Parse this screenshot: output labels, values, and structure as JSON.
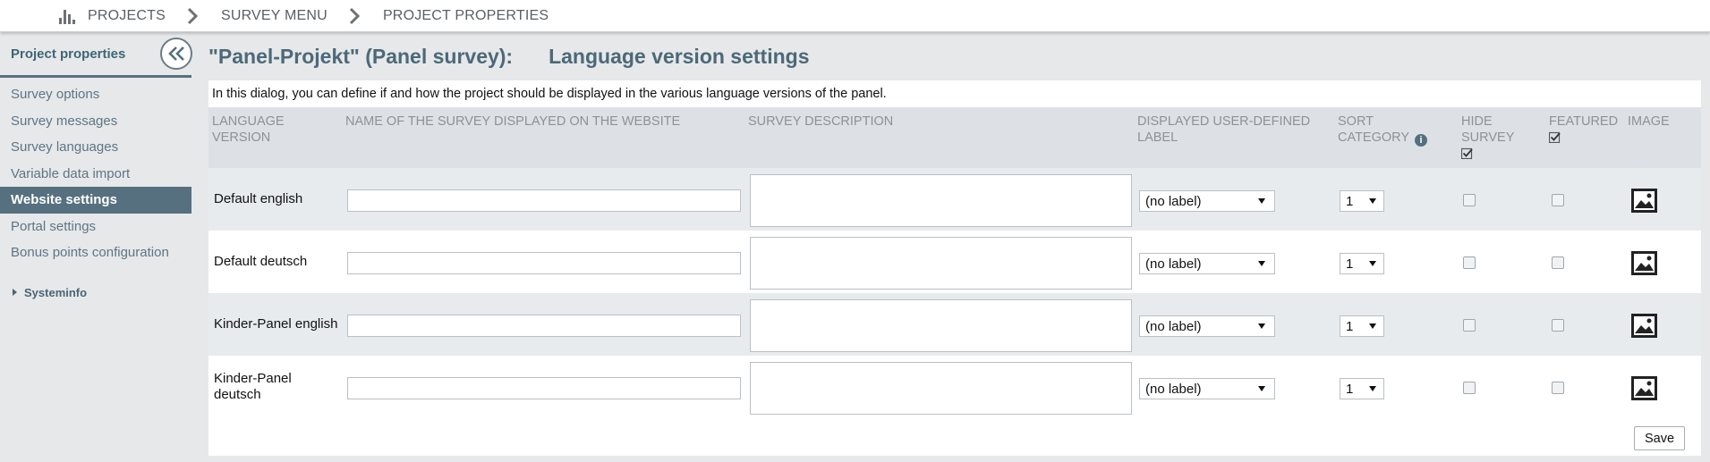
{
  "breadcrumb": {
    "items": [
      {
        "label": "PROJECTS",
        "icon": "bar-chart-icon"
      },
      {
        "label": "SURVEY MENU"
      },
      {
        "label": "PROJECT PROPERTIES"
      }
    ]
  },
  "sidebar": {
    "title": "Project properties",
    "items": [
      {
        "label": "Survey options",
        "active": false
      },
      {
        "label": "Survey messages",
        "active": false
      },
      {
        "label": "Survey languages",
        "active": false
      },
      {
        "label": "Variable data import",
        "active": false
      },
      {
        "label": "Website settings",
        "active": true
      },
      {
        "label": "Portal settings",
        "active": false
      },
      {
        "label": "Bonus points configuration",
        "active": false
      }
    ],
    "systeminfo_label": "Systeminfo"
  },
  "main": {
    "title": "\"Panel-Projekt\" (Panel survey):",
    "subtitle": "Language version settings",
    "intro": "In this dialog, you can define if and how the project should be displayed in the various language versions of the panel.",
    "columns": {
      "language_line1": "LANGUAGE",
      "language_line2": "VERSION",
      "name": "NAME OF THE SURVEY DISPLAYED ON THE WEBSITE",
      "description": "SURVEY DESCRIPTION",
      "label_line1": "DISPLAYED USER-DEFINED",
      "label_line2": "LABEL",
      "sort_line1": "SORT",
      "sort_line2": "CATEGORY",
      "hide_line1": "HIDE",
      "hide_line2": "SURVEY",
      "featured": "FEATURED",
      "image": "IMAGE"
    },
    "rows": [
      {
        "language_line1": "Default english",
        "language_line2": "",
        "name": "",
        "description": "",
        "label": "(no label)",
        "sort": "1"
      },
      {
        "language_line1": "Default deutsch",
        "language_line2": "",
        "name": "",
        "description": "",
        "label": "(no label)",
        "sort": "1"
      },
      {
        "language_line1": "Kinder-Panel english",
        "language_line2": "",
        "name": "",
        "description": "",
        "label": "(no label)",
        "sort": "1"
      },
      {
        "language_line1": "Kinder-Panel",
        "language_line2": "deutsch",
        "name": "",
        "description": "",
        "label": "(no label)",
        "sort": "1"
      }
    ],
    "save_label": "Save"
  },
  "colors": {
    "accent": "#56707f",
    "title": "#4c6978",
    "header_bg": "#dde1e6",
    "row_alt": "#e8ebee"
  }
}
